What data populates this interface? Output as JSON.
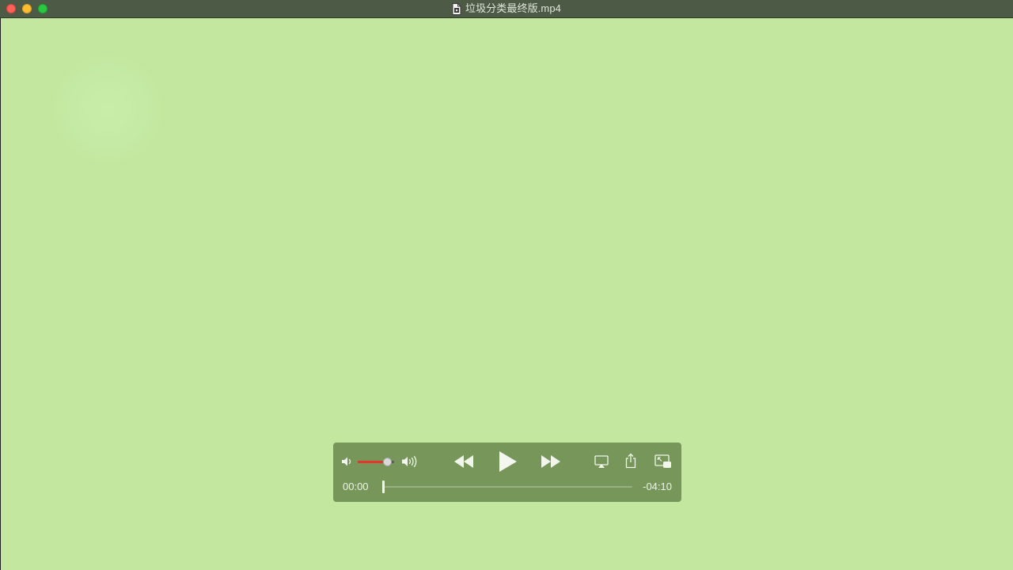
{
  "window": {
    "title": "垃圾分类最终版.mp4",
    "title_icon": "document-icon",
    "buttons": [
      "close",
      "minimize",
      "zoom"
    ]
  },
  "player": {
    "state": "paused",
    "volume": {
      "level_fraction": 0.82,
      "low_icon": "speaker-low-icon",
      "high_icon": "speaker-high-icon",
      "fill_color": "#e6342a"
    },
    "controls": {
      "rewind_icon": "rewind-icon",
      "play_icon": "play-icon",
      "forward_icon": "fast-forward-icon",
      "airplay_icon": "airplay-icon",
      "share_icon": "share-icon",
      "pip_icon": "picture-in-picture-icon"
    },
    "elapsed": "00:00",
    "remaining": "-04:10",
    "progress_fraction": 0.0
  },
  "colors": {
    "video_background": "#c3e79e",
    "hud_background": "#779659",
    "titlebar": "#4d5a46"
  }
}
